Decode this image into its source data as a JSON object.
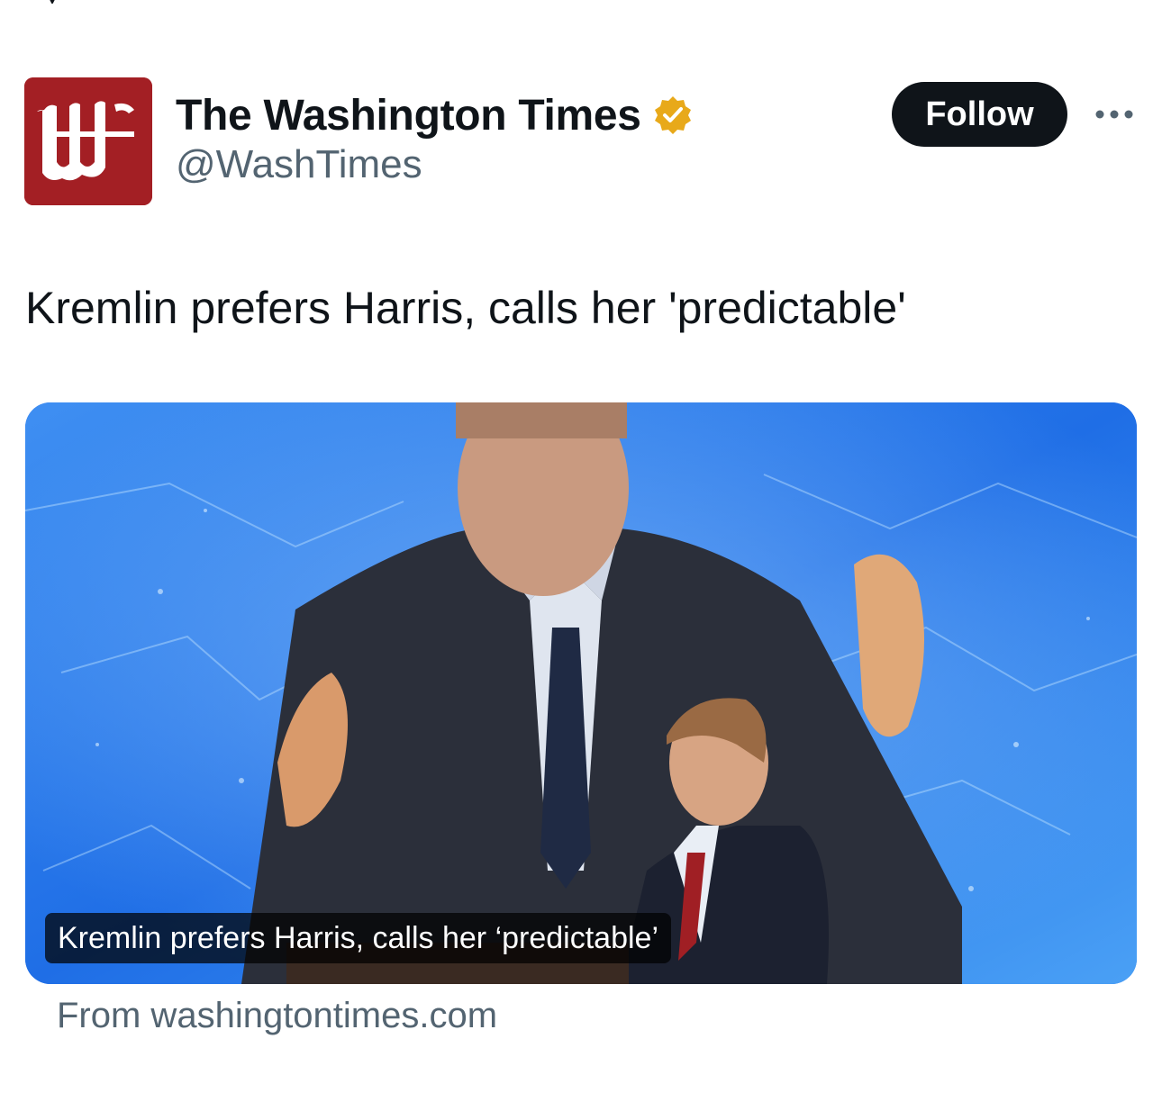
{
  "author": {
    "display_name": "The Washington Times",
    "handle": "@WashTimes",
    "avatar_letter": "W",
    "verified": true,
    "avatar_color": "#a31f24",
    "badge_color": "#e8a91a"
  },
  "actions": {
    "follow_label": "Follow",
    "more_icon": "more-horizontal-icon"
  },
  "post": {
    "text": "Kremlin prefers Harris, calls her 'predictable'"
  },
  "card": {
    "overlay_title": "Kremlin prefers Harris, calls her ‘predictable’",
    "source": "From washingtontimes.com"
  },
  "colors": {
    "primary_text": "#0f1419",
    "secondary_text": "#536471",
    "follow_bg": "#0f1419"
  }
}
